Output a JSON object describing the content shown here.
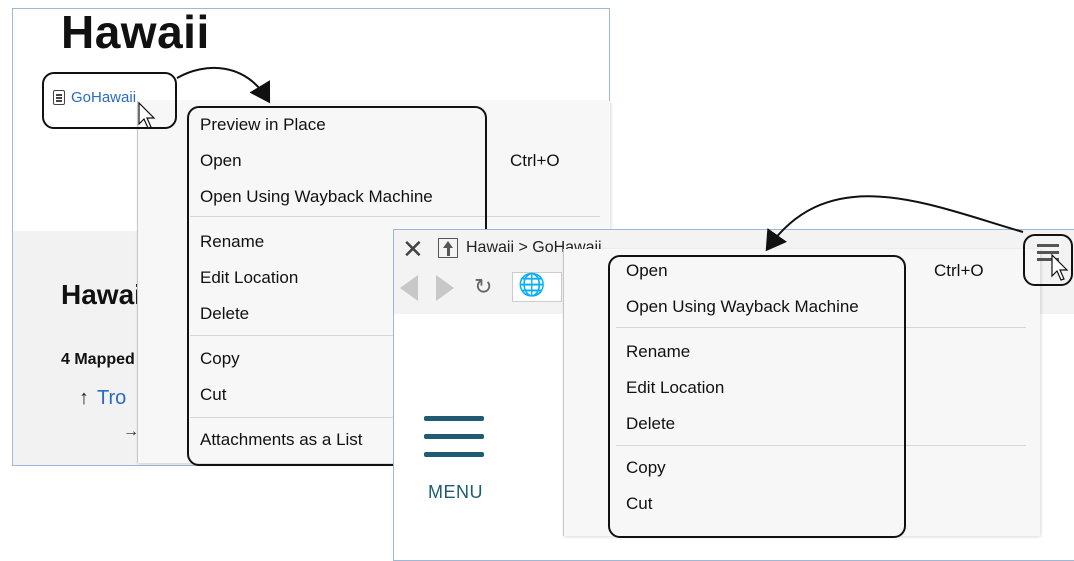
{
  "left_window": {
    "page_title": "Hawaii",
    "link_label": "GoHawaii",
    "section_title": "Hawaii",
    "section_subtitle": "4 Mapped",
    "trop_arrow": "↑",
    "trop_link": "Tro",
    "child_arrow": "→"
  },
  "left_menu": {
    "items": [
      {
        "label": "Preview in Place",
        "shortcut": ""
      },
      {
        "label": "Open",
        "shortcut": "Ctrl+O"
      },
      {
        "label": "Open Using Wayback Machine",
        "shortcut": ""
      },
      {
        "label": "Rename",
        "shortcut": ""
      },
      {
        "label": "Edit Location",
        "shortcut": ""
      },
      {
        "label": "Delete",
        "shortcut": ""
      },
      {
        "label": "Copy",
        "shortcut": ""
      },
      {
        "label": "Cut",
        "shortcut": ""
      },
      {
        "label": "Attachments as a List",
        "shortcut": ""
      }
    ]
  },
  "right_window": {
    "breadcrumb": "Hawaii > GoHawaii",
    "menu_label": "MENU"
  },
  "right_menu": {
    "items": [
      {
        "label": "Open",
        "shortcut": "Ctrl+O"
      },
      {
        "label": "Open Using Wayback Machine",
        "shortcut": ""
      },
      {
        "label": "Rename",
        "shortcut": ""
      },
      {
        "label": "Edit Location",
        "shortcut": ""
      },
      {
        "label": "Delete",
        "shortcut": ""
      },
      {
        "label": "Copy",
        "shortcut": ""
      },
      {
        "label": "Cut",
        "shortcut": ""
      }
    ]
  },
  "icons": {
    "link_icon": "document-icon",
    "close": "close-icon",
    "up": "up-arrow-icon",
    "back": "back-arrow-icon",
    "forward": "forward-arrow-icon",
    "reload": "reload-icon",
    "globe": "globe-icon",
    "hamburger": "hamburger-icon",
    "cursor": "cursor-icon"
  },
  "colors": {
    "link_blue": "#2a6cc0",
    "menu_teal": "#1f5b73",
    "window_border": "#9fb7d6"
  }
}
